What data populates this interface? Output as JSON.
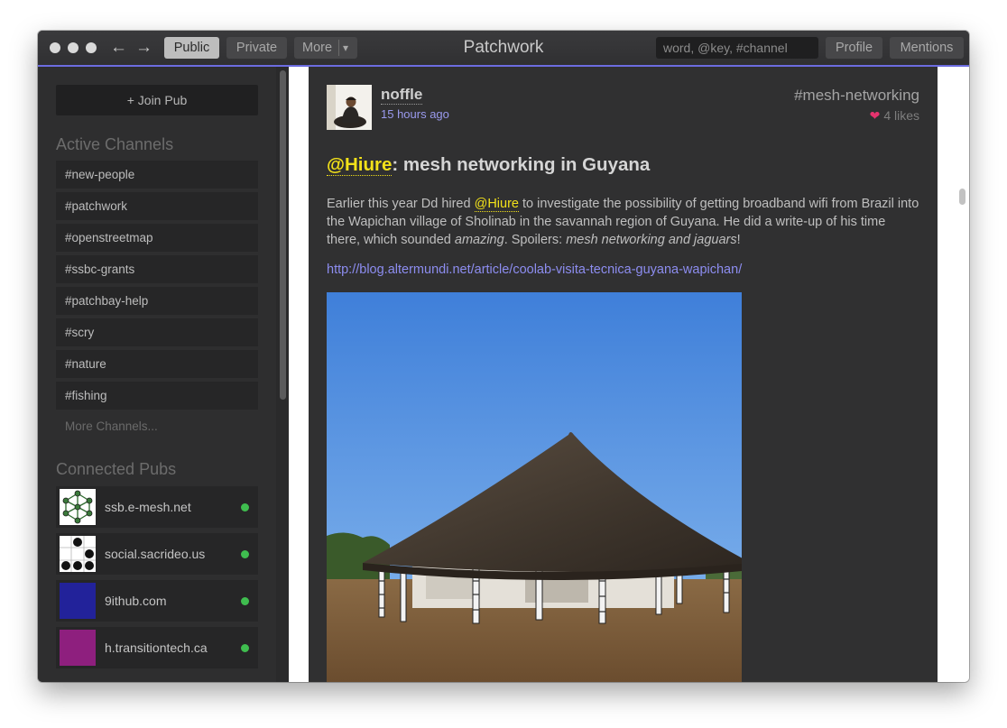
{
  "app": {
    "title": "Patchwork"
  },
  "toolbar": {
    "public_label": "Public",
    "private_label": "Private",
    "more_label": "More",
    "more_caret": "▾",
    "back_arrow": "←",
    "forward_arrow": "→",
    "search_placeholder": "word, @key, #channel",
    "profile_label": "Profile",
    "mentions_label": "Mentions"
  },
  "sidebar": {
    "join_pub_label": "+ Join Pub",
    "active_channels_heading": "Active Channels",
    "channels": [
      "#new-people",
      "#patchwork",
      "#openstreetmap",
      "#ssbc-grants",
      "#patchbay-help",
      "#scry",
      "#nature",
      "#fishing"
    ],
    "more_channels_label": "More Channels...",
    "connected_pubs_heading": "Connected Pubs",
    "pubs": [
      {
        "name": "ssb.e-mesh.net",
        "status_color": "#3fbd4f"
      },
      {
        "name": "social.sacrideo.us",
        "status_color": "#3fbd4f"
      },
      {
        "name": "9ithub.com",
        "status_color": "#3fbd4f",
        "avatar_color": "#22229a"
      },
      {
        "name": "h.transitiontech.ca",
        "status_color": "#3fbd4f",
        "avatar_color": "#8e1f7e"
      }
    ]
  },
  "post": {
    "author": "noffle",
    "timestamp": "15 hours ago",
    "channel": "#mesh-networking",
    "likes_icon": "❤",
    "likes": "4 likes",
    "title_mention": "@Hiure",
    "title_rest": ": mesh networking in Guyana",
    "body_part1": "Earlier this year Dd hired ",
    "body_mention": "@Hiure",
    "body_part2": " to investigate the possibility of getting broadband wifi from Brazil into the Wapichan village of Sholinab in the savannah region of Guyana. He did a write-up of his time there, which sounded ",
    "body_em1": "amazing",
    "body_part3": ". Spoilers: ",
    "body_em2": "mesh networking and jaguars",
    "body_part4": "!",
    "link": "http://blog.altermundi.net/article/coolab-visita-tecnica-guyana-wapichan/"
  },
  "colors": {
    "accent": "#6c6ce0",
    "mention": "#f2e11a",
    "link": "#8d8df0",
    "heart": "#e5336e",
    "online": "#3fbd4f"
  }
}
